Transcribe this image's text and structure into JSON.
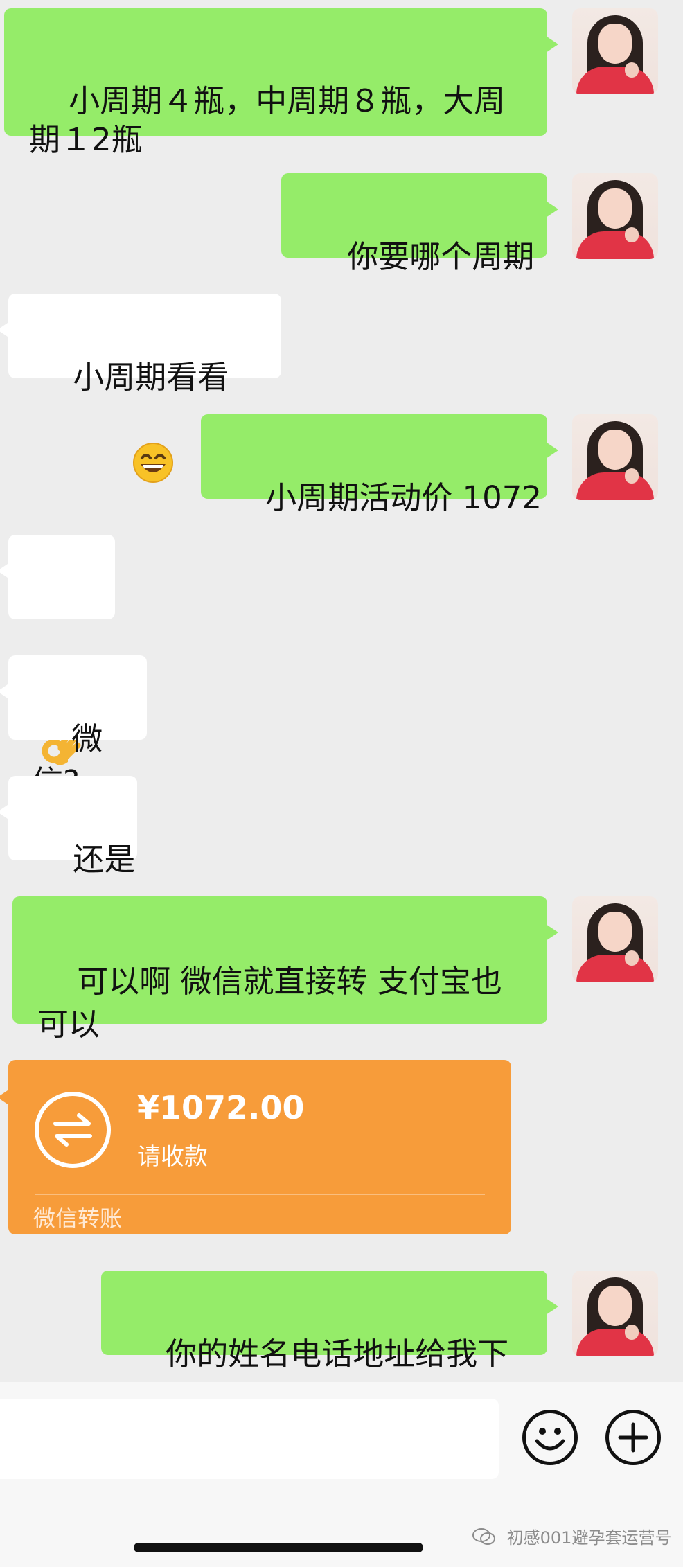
{
  "messages": [
    {
      "id": "m1",
      "side": "out",
      "text": "小周期４瓶，中周期８瓶，大周\n期１2瓶"
    },
    {
      "id": "m2",
      "side": "out",
      "text": "你要哪个周期"
    },
    {
      "id": "m3",
      "side": "in",
      "text": "小周期看看"
    },
    {
      "id": "m4",
      "side": "out",
      "text": "小周期活动价 1072"
    },
    {
      "id": "m5",
      "side": "in",
      "text": ""
    },
    {
      "id": "m6",
      "side": "in",
      "text": "微信?"
    },
    {
      "id": "m7",
      "side": "in",
      "text": "还是"
    },
    {
      "id": "m8",
      "side": "out",
      "text": "可以啊 微信就直接转 支付宝也\n可以"
    },
    {
      "id": "m10",
      "side": "out",
      "text": "你的姓名电话地址给我下"
    }
  ],
  "transfer": {
    "amount": "¥1072.00",
    "status": "请收款",
    "label": "微信转账",
    "accent": "#f79c3a"
  },
  "colors": {
    "outgoing": "#95ec69",
    "incoming": "#ffffff",
    "background": "#ededed"
  },
  "icons": {
    "emoji_grin": "grinning-face-emoji",
    "emoji_ok": "ok-hand-emoji",
    "input_emoji": "smiley-icon",
    "input_more": "plus-circle-icon"
  },
  "watermark": "初感001避孕套运营号"
}
